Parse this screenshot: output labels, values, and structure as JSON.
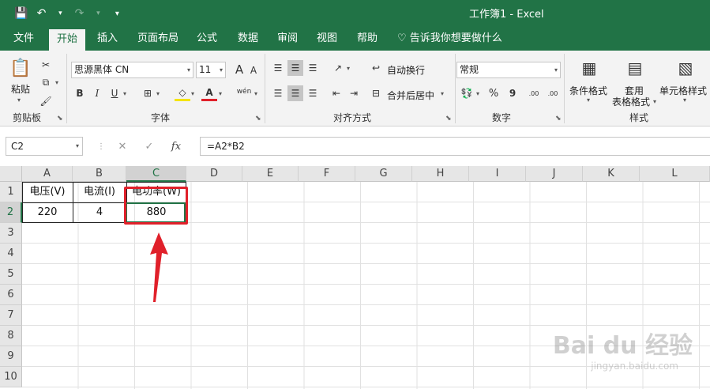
{
  "window": {
    "title": "工作簿1  -  Excel"
  },
  "qat": {
    "save": "💾",
    "undo": "↶",
    "redo": "↷",
    "more": "▾"
  },
  "tabs": [
    "文件",
    "开始",
    "插入",
    "页面布局",
    "公式",
    "数据",
    "审阅",
    "视图",
    "帮助"
  ],
  "tell_me": "告诉我你想要做什么",
  "ribbon": {
    "clipboard": {
      "paste": "粘贴",
      "label": "剪贴板"
    },
    "font": {
      "name": "思源黑体 CN",
      "size": "11",
      "bold": "B",
      "italic": "I",
      "underline": "U",
      "grow": "A",
      "shrink": "A",
      "phonetic": "wén",
      "label": "字体"
    },
    "alignment": {
      "wrap": "自动换行",
      "merge": "合并后居中",
      "label": "对齐方式"
    },
    "number": {
      "format": "常规",
      "percent": "%",
      "comma": "9",
      "inc": ".00",
      "label": "数字"
    },
    "styles": {
      "conditional": "条件格式",
      "table1": "套用",
      "table2": "表格格式",
      "cell": "单元格样式",
      "label": "样式"
    }
  },
  "formula_bar": {
    "name_box": "C2",
    "formula": "=A2*B2",
    "fx": "fx",
    "cancel": "✕",
    "enter": "✓"
  },
  "columns": [
    "A",
    "B",
    "C",
    "D",
    "E",
    "F",
    "G",
    "H",
    "I",
    "J",
    "K",
    "L"
  ],
  "rows": [
    "1",
    "2",
    "3",
    "4",
    "5",
    "6",
    "7",
    "8",
    "9",
    "10"
  ],
  "cells": {
    "A1": "电压(V)",
    "B1": "电流(I)",
    "C1": "电功率(W)",
    "A2": "220",
    "B2": "4",
    "C2": "880"
  },
  "watermark": {
    "main": "Bai du 经验",
    "sub": "jingyan.baidu.com"
  },
  "colors": {
    "brand": "#217346",
    "highlight": "#e0202a"
  }
}
